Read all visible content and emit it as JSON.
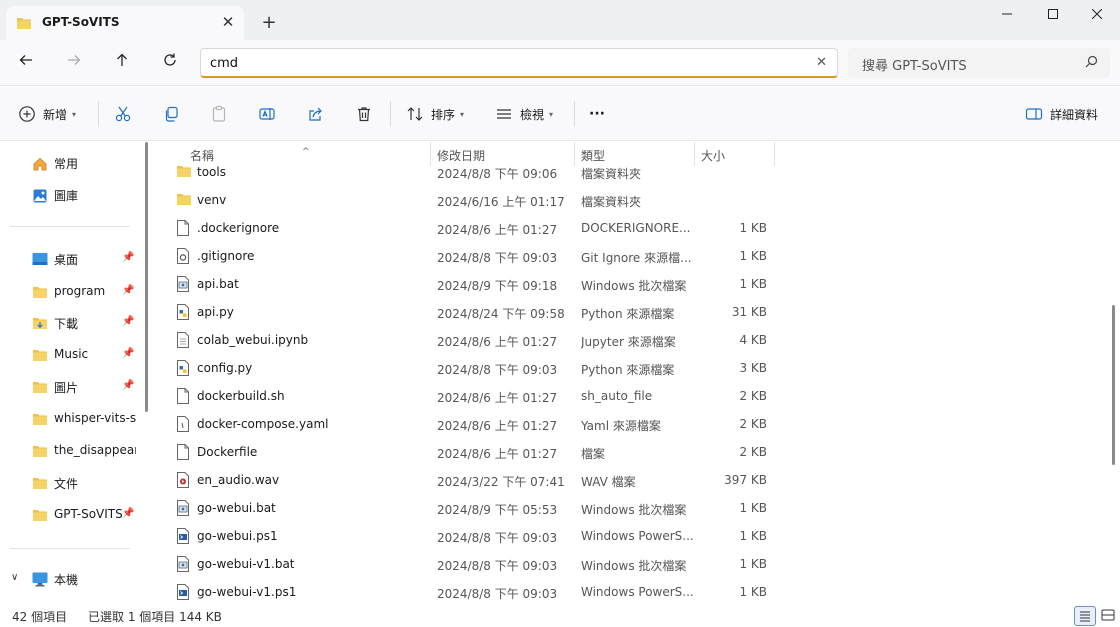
{
  "window": {
    "tab_title": "GPT-SoVITS",
    "new_tab_icon": "+"
  },
  "address": {
    "value": "cmd",
    "search_placeholder": "搜尋 GPT-SoVITS"
  },
  "toolbar": {
    "new_label": "新增",
    "sort_label": "排序",
    "view_label": "檢視",
    "more_label": "···",
    "details_label": "詳細資料"
  },
  "sidebar": {
    "items": [
      {
        "label": "常用",
        "icon": "home-icon"
      },
      {
        "label": "圖庫",
        "icon": "gallery-icon"
      },
      {
        "label": "桌面",
        "icon": "desktop-icon",
        "pinned": true
      },
      {
        "label": "program",
        "icon": "folder-icon",
        "pinned": true
      },
      {
        "label": "下載",
        "icon": "download-folder-icon",
        "pinned": true
      },
      {
        "label": "Music",
        "icon": "folder-icon",
        "pinned": true
      },
      {
        "label": "圖片",
        "icon": "folder-icon",
        "pinned": true
      },
      {
        "label": "whisper-vits-svc",
        "icon": "folder-icon"
      },
      {
        "label": "the_disappearance",
        "icon": "folder-icon"
      },
      {
        "label": "文件",
        "icon": "folder-icon"
      },
      {
        "label": "GPT-SoVITS",
        "icon": "folder-icon",
        "pinned": true
      },
      {
        "label": "本機",
        "icon": "computer-icon"
      }
    ]
  },
  "columns": {
    "name": "名稱",
    "date": "修改日期",
    "type": "類型",
    "size": "大小"
  },
  "files": [
    {
      "name": "tools",
      "date": "2024/8/8 下午 09:06",
      "type": "檔案資料夾",
      "size": "",
      "icon": "folder-icon"
    },
    {
      "name": "venv",
      "date": "2024/6/16 上午 01:17",
      "type": "檔案資料夾",
      "size": "",
      "icon": "folder-icon"
    },
    {
      "name": ".dockerignore",
      "date": "2024/8/6 上午 01:27",
      "type": "DOCKERIGNORE...",
      "size": "1 KB",
      "icon": "file-icon"
    },
    {
      "name": ".gitignore",
      "date": "2024/8/8 下午 09:03",
      "type": "Git Ignore 來源檔...",
      "size": "1 KB",
      "icon": "config-file-icon"
    },
    {
      "name": "api.bat",
      "date": "2024/8/9 下午 09:18",
      "type": "Windows 批次檔案",
      "size": "1 KB",
      "icon": "batch-file-icon"
    },
    {
      "name": "api.py",
      "date": "2024/8/24 下午 09:58",
      "type": "Python 來源檔案",
      "size": "31 KB",
      "icon": "python-file-icon"
    },
    {
      "name": "colab_webui.ipynb",
      "date": "2024/8/6 上午 01:27",
      "type": "Jupyter 來源檔案",
      "size": "4 KB",
      "icon": "text-file-icon"
    },
    {
      "name": "config.py",
      "date": "2024/8/8 下午 09:03",
      "type": "Python 來源檔案",
      "size": "3 KB",
      "icon": "python-file-icon"
    },
    {
      "name": "dockerbuild.sh",
      "date": "2024/8/6 上午 01:27",
      "type": "sh_auto_file",
      "size": "2 KB",
      "icon": "file-icon"
    },
    {
      "name": "docker-compose.yaml",
      "date": "2024/8/6 上午 01:27",
      "type": "Yaml 來源檔案",
      "size": "2 KB",
      "icon": "yaml-file-icon"
    },
    {
      "name": "Dockerfile",
      "date": "2024/8/6 上午 01:27",
      "type": "檔案",
      "size": "2 KB",
      "icon": "file-icon"
    },
    {
      "name": "en_audio.wav",
      "date": "2024/3/22 下午 07:41",
      "type": "WAV 檔案",
      "size": "397 KB",
      "icon": "audio-file-icon"
    },
    {
      "name": "go-webui.bat",
      "date": "2024/8/9 下午 05:53",
      "type": "Windows 批次檔案",
      "size": "1 KB",
      "icon": "batch-file-icon"
    },
    {
      "name": "go-webui.ps1",
      "date": "2024/8/8 下午 09:03",
      "type": "Windows PowerS...",
      "size": "1 KB",
      "icon": "powershell-file-icon"
    },
    {
      "name": "go-webui-v1.bat",
      "date": "2024/8/8 下午 09:03",
      "type": "Windows 批次檔案",
      "size": "1 KB",
      "icon": "batch-file-icon"
    },
    {
      "name": "go-webui-v1.ps1",
      "date": "2024/8/8 下午 09:03",
      "type": "Windows PowerS...",
      "size": "1 KB",
      "icon": "powershell-file-icon"
    }
  ],
  "status": {
    "item_count": "42 個項目",
    "selection": "已選取 1 個項目 144 KB"
  },
  "colors": {
    "folder": "#f0c14b",
    "address_accent": "#d39b1f",
    "accent_blue": "#1f6fc4"
  }
}
